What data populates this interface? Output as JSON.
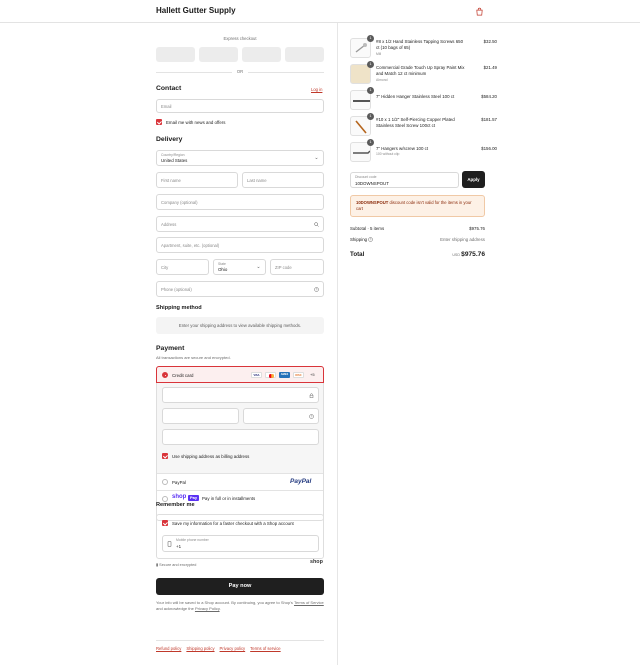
{
  "header": {
    "store_name": "Hallett Gutter Supply",
    "bag_icon": "shopping-bag-icon"
  },
  "express": {
    "label": "Express checkout",
    "or": "OR"
  },
  "contact": {
    "title": "Contact",
    "login_link": "Log in",
    "email_placeholder": "Email",
    "news_label": "Email me with news and offers",
    "news_checked": true
  },
  "delivery": {
    "title": "Delivery",
    "country_label": "Country/Region",
    "country_value": "United States",
    "first_name": "First name",
    "last_name": "Last name",
    "company": "Company (optional)",
    "address": "Address",
    "apartment": "Apartment, suite, etc. (optional)",
    "city": "City",
    "state_label": "State",
    "state_value": "Ohio",
    "zip": "ZIP code",
    "phone": "Phone (optional)"
  },
  "shipping_method": {
    "title": "Shipping method",
    "message": "Enter your shipping address to view available shipping methods."
  },
  "payment": {
    "title": "Payment",
    "subtitle": "All transactions are secure and encrypted.",
    "credit_card_label": "Credit card",
    "card_brands": [
      "VISA",
      "MC",
      "AMEX",
      "DISC"
    ],
    "more_cards": "+5",
    "billing_same_label": "Use shipping address as billing address",
    "paypal_label": "PayPal",
    "paypal_logo": "PayPal",
    "shoppay_logo": "shop",
    "shoppay_badge": "Pay",
    "shoppay_label": "Pay in full or in installments"
  },
  "remember": {
    "title": "Remember me",
    "save_label": "Save my information for a faster checkout with a Shop account",
    "mobile_label": "Mobile phone number",
    "mobile_prefix": "+1",
    "secure_label": "Secure and encrypted",
    "shop_logo": "shop"
  },
  "pay_button": "Pay now",
  "fine_print": {
    "line1": "Your info will be saved to a Shop account. By continuing, you agree to Shop's",
    "terms": "Terms of Service",
    "and": "and acknowledge the",
    "privacy": "Privacy Policy",
    "end": "."
  },
  "footer": {
    "links": [
      "Refund policy",
      "Shipping policy",
      "Privacy policy",
      "Terms of service"
    ]
  },
  "cart": {
    "items": [
      {
        "qty": "1",
        "name": "#8 x 1/2 Hand Stainless Tapping Screws 650 ct (10 bags of 65)",
        "variant": "Mill",
        "price": "$32.50"
      },
      {
        "qty": "1",
        "name": "Commercial Grade Touch Up Spray Paint Mix and Match 12 ct minimum",
        "variant": "Almond",
        "price": "$21.49"
      },
      {
        "qty": "1",
        "name": "7\" Hidden Hanger Stainless Steel 100 ct",
        "variant": "",
        "price": "$584.20"
      },
      {
        "qty": "1",
        "name": "#10 x 1 1/2\" Self-Piercing Copper Plated Stainless Steel Screw 100ct ct",
        "variant": "",
        "price": "$181.57"
      },
      {
        "qty": "1",
        "name": "7\" Hangers w/screw 100 ct",
        "variant": "100 without clip",
        "price": "$156.00"
      }
    ],
    "discount_label": "Discount code",
    "discount_value": "10DOWNSPOUT",
    "apply": "Apply",
    "alert_code": "10DOWNSPOUT",
    "alert_text": " discount code isn't valid for the items in your cart",
    "subtotal_label": "Subtotal · 5 items",
    "subtotal_value": "$975.76",
    "shipping_label": "Shipping",
    "shipping_value": "Enter shipping address",
    "total_label": "Total",
    "currency": "USD",
    "total_value": "$975.76"
  }
}
